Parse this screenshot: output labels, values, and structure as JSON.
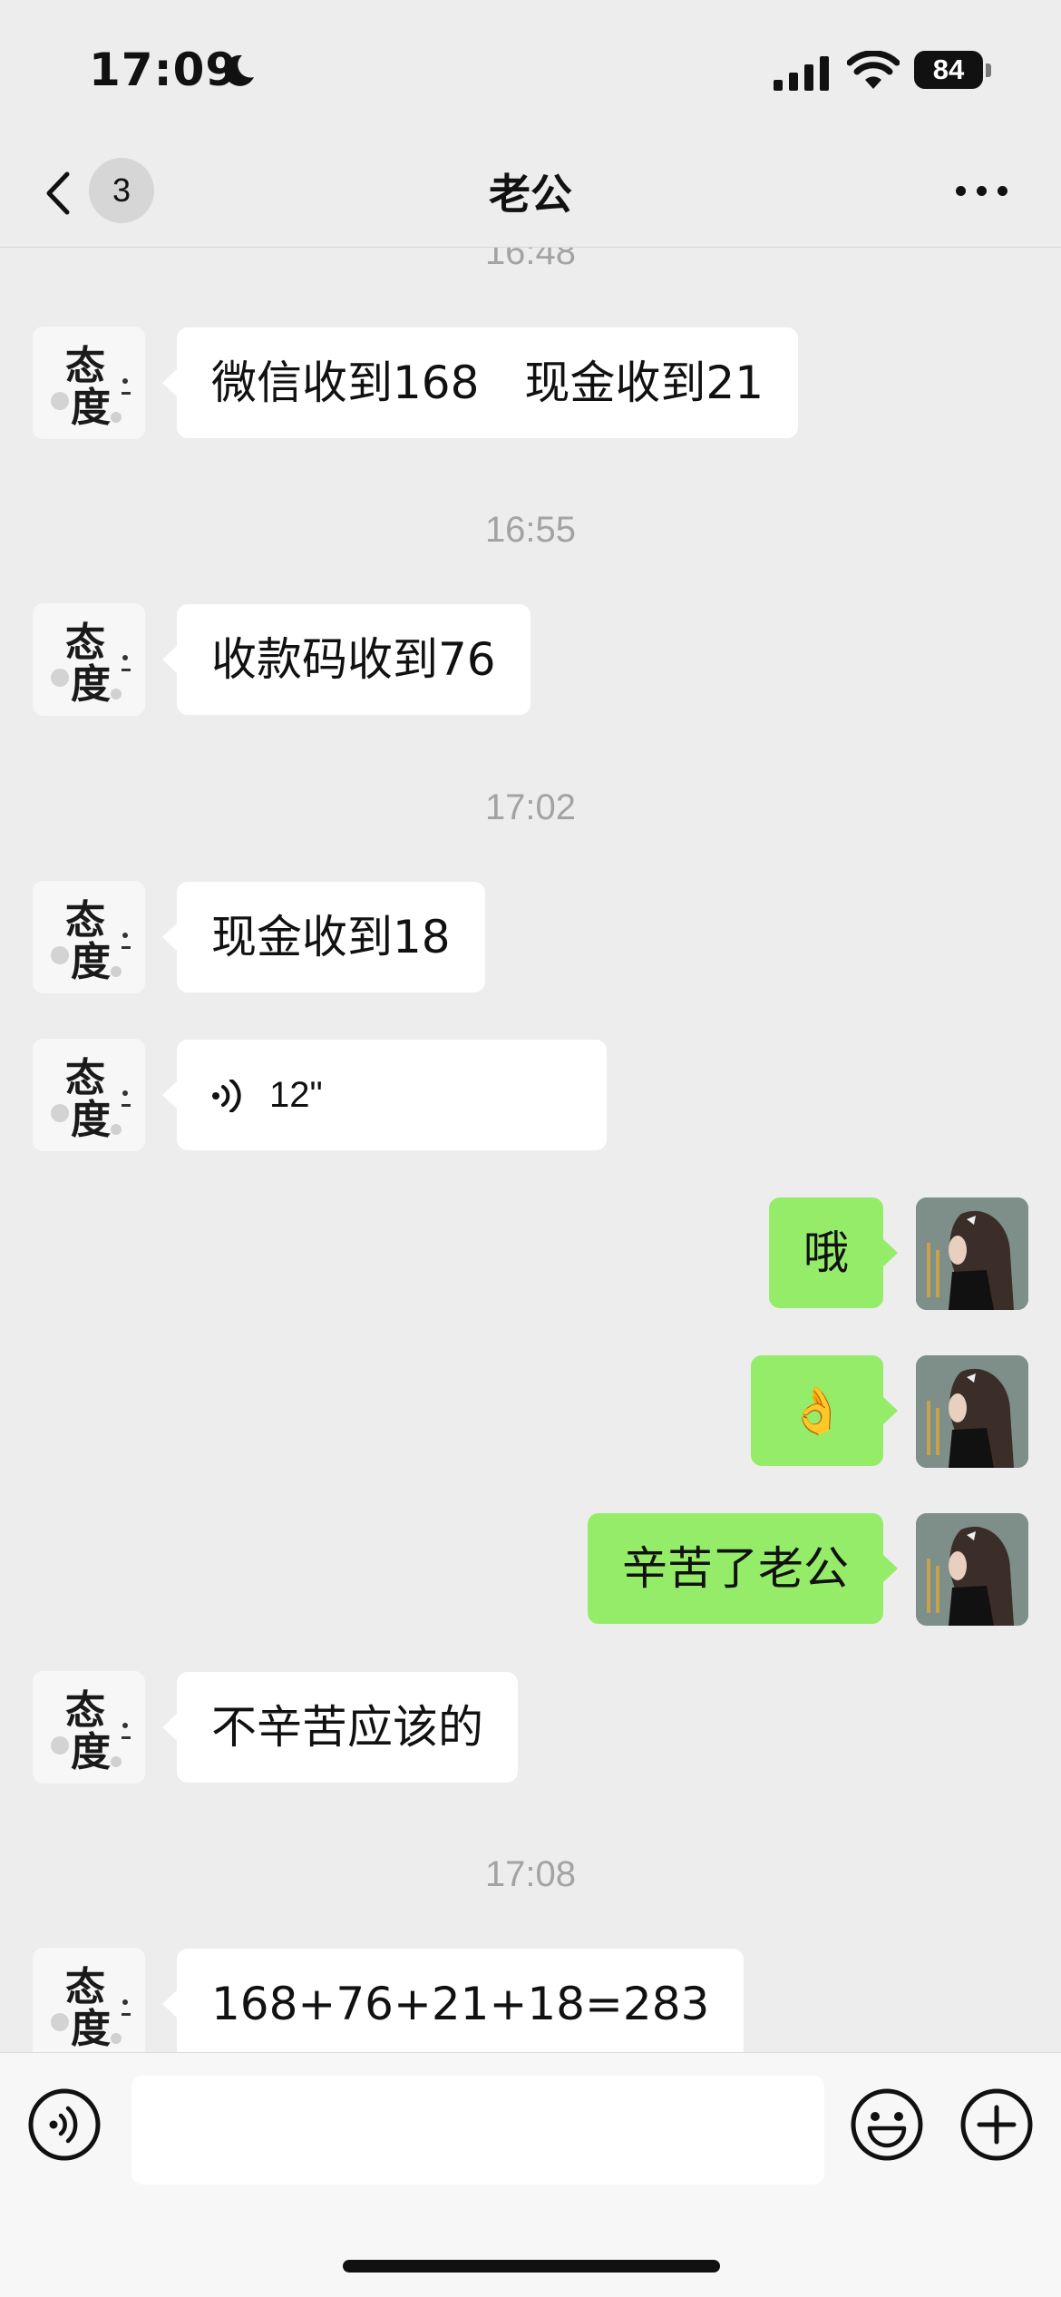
{
  "status_bar": {
    "time": "17:09",
    "battery": "84",
    "icons": [
      "moon-icon",
      "signal-icon",
      "wifi-icon",
      "battery-icon"
    ]
  },
  "nav": {
    "unread_count": "3",
    "title": "老公",
    "icons": [
      "back-chevron-icon",
      "more-icon"
    ]
  },
  "messages": {
    "ts_0": "16:48",
    "m0": "微信收到168　现金收到21",
    "ts_1": "16:55",
    "m1": "收款码收到76",
    "ts_2": "17:02",
    "m2": "现金收到18",
    "m3_voice_duration": "12\"",
    "m4": "哦",
    "m5": "👌",
    "m6": "辛苦了老公",
    "m7": "不辛苦应该的",
    "ts_3": "17:08",
    "m8": "168+76+21+18=283"
  },
  "avatars": {
    "contact_calligraphy": "态度",
    "self": "user-avatar-girl"
  },
  "input_bar": {
    "placeholder": "",
    "icons": [
      "voice-toggle-icon",
      "emoji-icon",
      "plus-icon"
    ]
  },
  "colors": {
    "background": "#ededed",
    "incoming_bubble": "#ffffff",
    "outgoing_bubble": "#95ec69",
    "timestamp": "#a3a3a3"
  }
}
